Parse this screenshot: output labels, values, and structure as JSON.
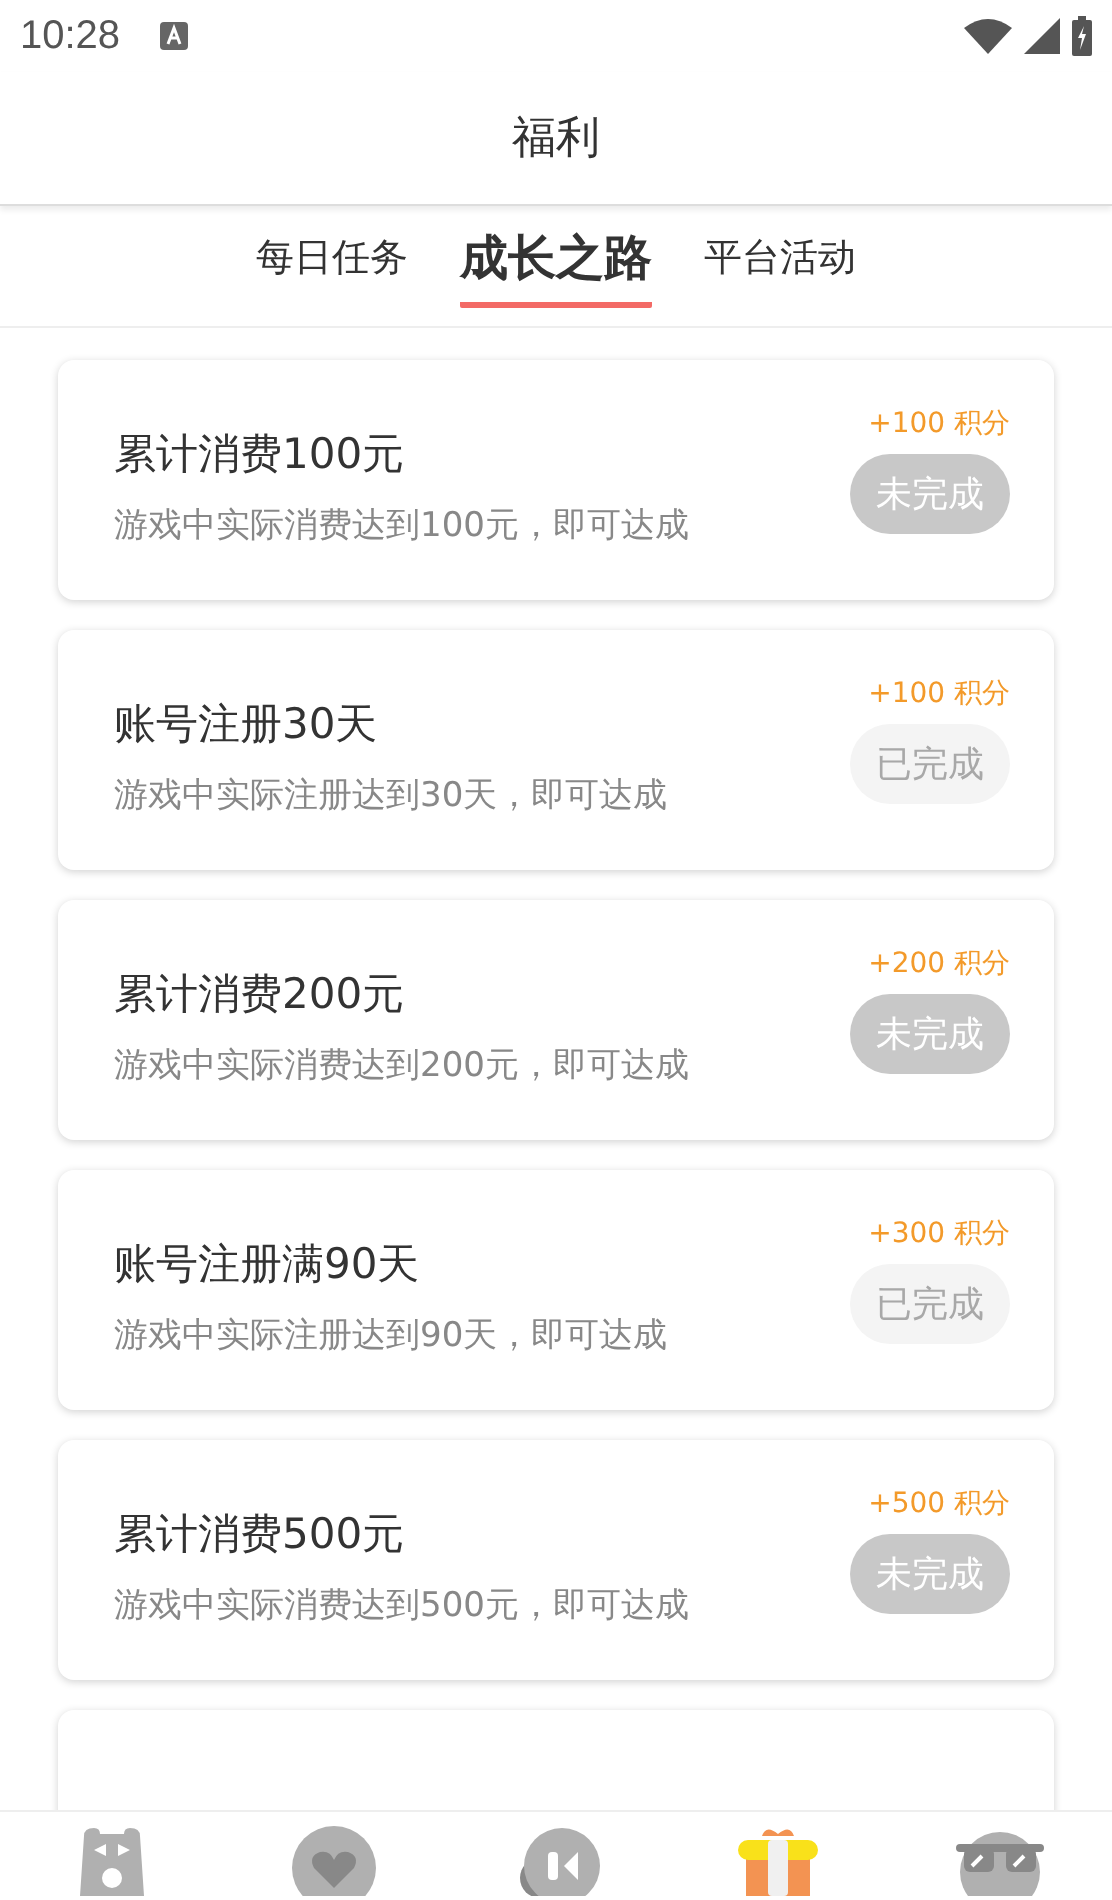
{
  "status_bar": {
    "time": "10:28"
  },
  "header": {
    "title": "福利"
  },
  "tabs": [
    {
      "label": "每日任务",
      "selected": false
    },
    {
      "label": "成长之路",
      "selected": true
    },
    {
      "label": "平台活动",
      "selected": false
    }
  ],
  "tasks": [
    {
      "title": "累计消费100元",
      "description": "游戏中实际消费达到100元，即可达成",
      "points": "+100 积分",
      "status": "未完成",
      "done": false
    },
    {
      "title": "账号注册30天",
      "description": "游戏中实际注册达到30天，即可达成",
      "points": "+100 积分",
      "status": "已完成",
      "done": true
    },
    {
      "title": "累计消费200元",
      "description": "游戏中实际消费达到200元，即可达成",
      "points": "+200 积分",
      "status": "未完成",
      "done": false
    },
    {
      "title": "账号注册满90天",
      "description": "游戏中实际注册达到90天，即可达成",
      "points": "+300 积分",
      "status": "已完成",
      "done": true
    },
    {
      "title": "累计消费500元",
      "description": "游戏中实际消费达到500元，即可达成",
      "points": "+500 积分",
      "status": "未完成",
      "done": false
    }
  ],
  "bottom_nav": [
    {
      "kind": "bear",
      "selected": false
    },
    {
      "kind": "heart",
      "selected": false
    },
    {
      "kind": "play",
      "selected": false
    },
    {
      "kind": "gift",
      "selected": true
    },
    {
      "kind": "glasses",
      "selected": false
    }
  ]
}
